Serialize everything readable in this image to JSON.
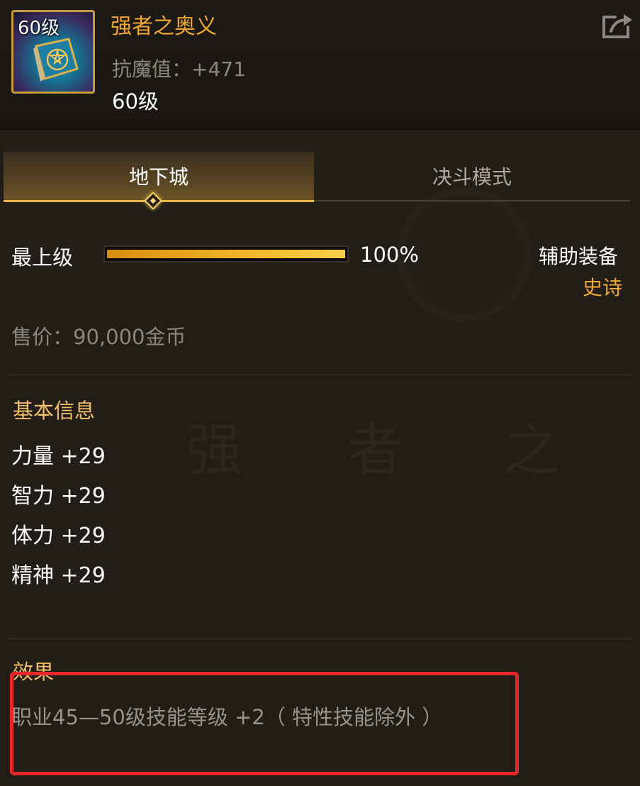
{
  "item": {
    "icon_level": "60级",
    "name": "强者之奥义",
    "stat": "抗魔值：+471",
    "level": "60级"
  },
  "tabs": {
    "active": "地下城",
    "inactive": "决斗模式"
  },
  "quality": {
    "label": "最上级",
    "percent": 100,
    "percent_text": "100%"
  },
  "equip_type": "辅助装备",
  "rarity": "史诗",
  "price": "售价：90,000金币",
  "basic_info": {
    "title": "基本信息",
    "stats": [
      "力量 +29",
      "智力 +29",
      "体力 +29",
      "精神 +29"
    ]
  },
  "effect": {
    "title": "效果",
    "text": "职业45—50级技能等级 +2（ 特性技能除外 ）"
  },
  "watermark": [
    "强",
    "者",
    "之"
  ],
  "colors": {
    "gold_title": "#f0a830",
    "highlight_red": "#e5262a",
    "tab_accent": "#e7b545"
  }
}
